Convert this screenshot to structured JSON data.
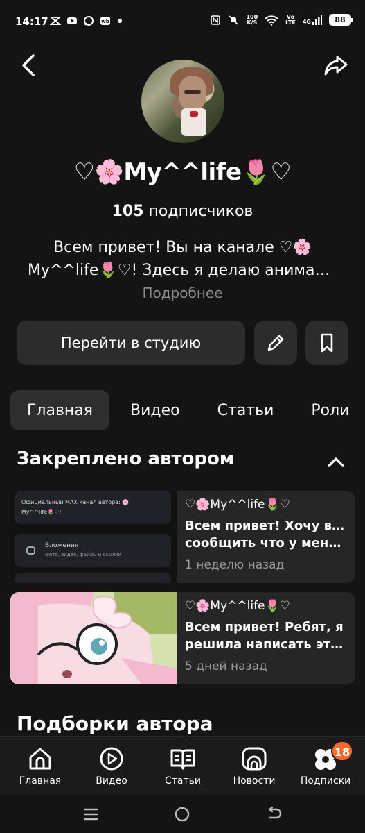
{
  "status_bar": {
    "time": "14:17",
    "network_speed_value": "100",
    "network_speed_unit": "K/S",
    "volte": "Vo",
    "lte": "LTE",
    "signal_type": "4G",
    "battery": "88"
  },
  "channel": {
    "name": "♡🌸My^^life🌷♡",
    "subscribers_count": "105",
    "subscribers_label": "подписчиков",
    "description_line1": "Всем привет! Вы на канале ♡🌸",
    "description_line2": "My^^life🌷♡! Здесь я делаю анимац...",
    "more_label": "Подробнее"
  },
  "actions": {
    "studio_label": "Перейти в студию"
  },
  "tabs": [
    {
      "label": "Главная",
      "active": true
    },
    {
      "label": "Видео",
      "active": false
    },
    {
      "label": "Статьи",
      "active": false
    },
    {
      "label": "Роли",
      "active": false
    }
  ],
  "pinned": {
    "title": "Закреплено автором",
    "thumb1": {
      "line1": "Официальный MAX канал автора: 🌸",
      "line2": "My^^life🌷♡!",
      "item1_title": "Вложения",
      "item1_sub": "Фото, видео, файлы и ссылки"
    },
    "cards": [
      {
        "author": "♡🌸My^^life🌷♡",
        "text_line1": "Всем привет! Хочу вам",
        "text_line2": "сообщить что у меня п...",
        "time": "1 неделю назад"
      },
      {
        "author": "♡🌸My^^life🌷♡",
        "text_line1": "Всем привет! Ребят, я",
        "text_line2": "решила написать этот...",
        "time": "5 дней назад"
      }
    ]
  },
  "collections_title": "Подборки автора",
  "bottom_nav": [
    {
      "label": "Главная",
      "icon": "home-icon"
    },
    {
      "label": "Видео",
      "icon": "video-play-icon"
    },
    {
      "label": "Статьи",
      "icon": "articles-book-icon"
    },
    {
      "label": "Новости",
      "icon": "news-icon"
    },
    {
      "label": "Подписки",
      "icon": "subscriptions-icon",
      "badge": "18"
    }
  ],
  "colors": {
    "background": "#141414",
    "card": "#262626",
    "badge": "#ff6a2a",
    "muted_text": "#8a8a8a"
  }
}
